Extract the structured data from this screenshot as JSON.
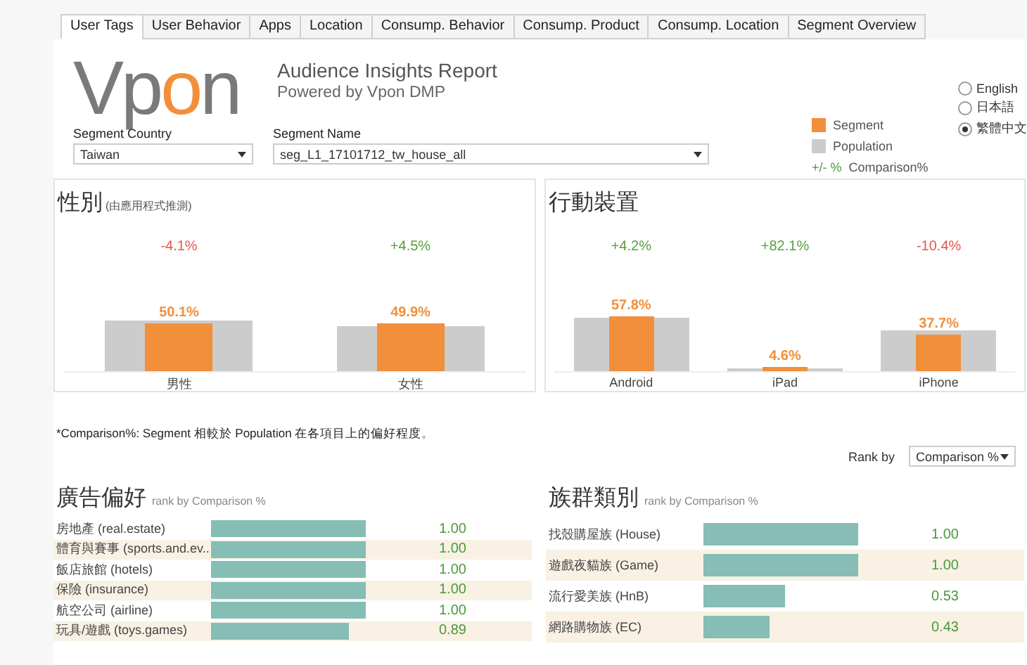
{
  "tabs": [
    {
      "label": "User Tags",
      "selected": true
    },
    {
      "label": "User Behavior",
      "selected": false
    },
    {
      "label": "Apps",
      "selected": false
    },
    {
      "label": "Location",
      "selected": false
    },
    {
      "label": "Consump. Behavior",
      "selected": false
    },
    {
      "label": "Consump. Product",
      "selected": false
    },
    {
      "label": "Consump. Location",
      "selected": false
    },
    {
      "label": "Segment Overview",
      "selected": false
    }
  ],
  "logo": {
    "parts": [
      {
        "text": "Vp",
        "accent": false
      },
      {
        "text": "o",
        "accent": true
      },
      {
        "text": "n",
        "accent": false
      }
    ]
  },
  "report": {
    "title": "Audience Insights Report",
    "subtitle": "Powered by Vpon DMP"
  },
  "filters": [
    {
      "label": "Segment Country",
      "value": "Taiwan",
      "kind": "short"
    },
    {
      "label": "Segment Name",
      "value": "seg_L1_17101712_tw_house_all",
      "kind": "wide"
    }
  ],
  "legend": {
    "segment": "Segment",
    "population": "Population",
    "comparison_mark": "+/- %",
    "comparison": "Comparison%"
  },
  "languages": [
    {
      "label": "English",
      "selected": false
    },
    {
      "label": "日本語",
      "selected": false
    },
    {
      "label": "繁體中文",
      "selected": true
    }
  ],
  "panels": [
    {
      "title": "性別",
      "note": "(由應用程式推測)",
      "items": [
        {
          "label": "男性",
          "value": "50.1%",
          "comparison": "-4.1%"
        },
        {
          "label": "女性",
          "value": "49.9%",
          "comparison": "+4.5%"
        }
      ]
    },
    {
      "title": "行動裝置",
      "items": [
        {
          "label": "Android",
          "value": "57.8%",
          "comparison": "+4.2%"
        },
        {
          "label": "iPad",
          "value": "4.6%",
          "comparison": "+82.1%"
        },
        {
          "label": "iPhone",
          "value": "37.7%",
          "comparison": "-10.4%"
        }
      ]
    }
  ],
  "footnote": "*Comparison%: Segment 相較於 Population 在各項目上的偏好程度。",
  "rank_by": {
    "label": "Rank by",
    "value": "Comparison %"
  },
  "lists": [
    {
      "title": "廣告偏好",
      "subtitle": "rank by Comparison %",
      "kind": "compact",
      "rows": [
        {
          "label": "房地產 (real.estate)",
          "value": "1.00"
        },
        {
          "label": "體育與賽事 (sports.and.ev..",
          "value": "1.00"
        },
        {
          "label": "飯店旅館 (hotels)",
          "value": "1.00"
        },
        {
          "label": "保險 (insurance)",
          "value": "1.00"
        },
        {
          "label": "航空公司 (airline)",
          "value": "1.00"
        },
        {
          "label": "玩具/遊戲 (toys.games)",
          "value": "0.89"
        }
      ]
    },
    {
      "title": "族群類別",
      "subtitle": "rank by Comparison %",
      "kind": "tall",
      "rows": [
        {
          "label": "找殼購屋族 (House)",
          "value": "1.00"
        },
        {
          "label": "遊戲夜貓族 (Game)",
          "value": "1.00"
        },
        {
          "label": "流行愛美族 (HnB)",
          "value": "0.53"
        },
        {
          "label": "網路購物族 (EC)",
          "value": "0.43"
        }
      ]
    }
  ]
}
